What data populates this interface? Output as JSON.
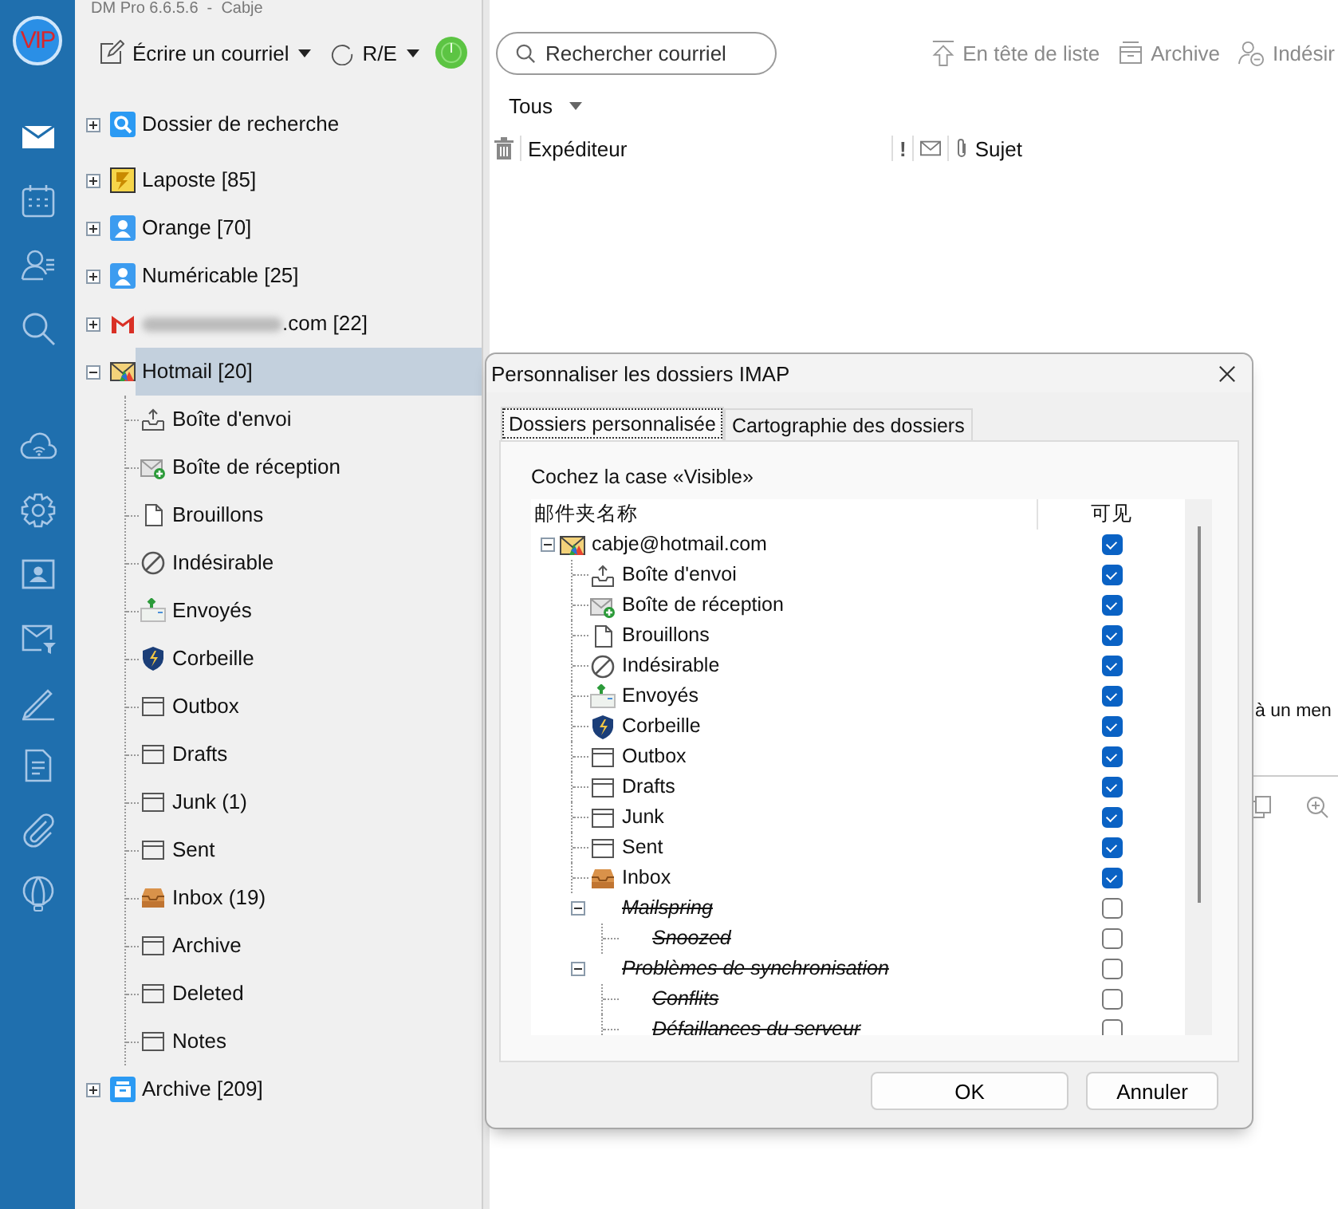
{
  "title_bar": {
    "title": "DM Pro 6.6.5.6  -  Cabje"
  },
  "rail": {
    "badge": "VIP",
    "top_items": [
      {
        "kind": "mail",
        "selected": true
      },
      {
        "kind": "calendar",
        "selected": false
      },
      {
        "kind": "contacts",
        "selected": false
      },
      {
        "kind": "search",
        "selected": false
      }
    ],
    "bottom_items": [
      {
        "kind": "cloud",
        "selected": false
      },
      {
        "kind": "settings",
        "selected": false
      },
      {
        "kind": "card",
        "selected": false
      },
      {
        "kind": "mail-filter",
        "selected": false
      },
      {
        "kind": "pen",
        "selected": false
      },
      {
        "kind": "note",
        "selected": false
      },
      {
        "kind": "clip",
        "selected": false
      },
      {
        "kind": "balloon",
        "selected": false
      }
    ]
  },
  "toolbar": {
    "compose": "Écrire un courriel",
    "send_receive": "R/E"
  },
  "sidebar": {
    "tree": [
      {
        "label": "Dossier de recherche",
        "kind": "search",
        "expanded": false,
        "selected": false
      },
      {
        "label": "Laposte [85]",
        "kind": "laposte",
        "expanded": false,
        "selected": false
      },
      {
        "label": "Orange [70]",
        "kind": "contact",
        "expanded": false,
        "selected": false
      },
      {
        "label": "Numéricable [25]",
        "kind": "contact",
        "expanded": false,
        "selected": false
      },
      {
        "label": ".com [22]",
        "kind": "gmail",
        "blurred": true,
        "expanded": false,
        "selected": false
      },
      {
        "label": "Hotmail [20]",
        "kind": "hotmail",
        "expanded": true,
        "selected": true,
        "children": [
          {
            "label": "Boîte d'envoi",
            "kind": "outbox",
            "selected": false
          },
          {
            "label": "Boîte de réception",
            "kind": "inbox-in",
            "selected": false
          },
          {
            "label": "Brouillons",
            "kind": "draft",
            "selected": false
          },
          {
            "label": "Indésirable",
            "kind": "blocked",
            "selected": false
          },
          {
            "label": "Envoyés",
            "kind": "sent",
            "selected": false
          },
          {
            "label": "Corbeille",
            "kind": "shield",
            "selected": false
          },
          {
            "label": "Outbox",
            "kind": "folder",
            "selected": false
          },
          {
            "label": "Drafts",
            "kind": "folder",
            "selected": false
          },
          {
            "label": "Junk (1)",
            "kind": "folder",
            "selected": false
          },
          {
            "label": "Sent",
            "kind": "folder",
            "selected": false
          },
          {
            "label": "Inbox (19)",
            "kind": "tray",
            "selected": false
          },
          {
            "label": "Archive",
            "kind": "folder",
            "selected": false
          },
          {
            "label": "Deleted",
            "kind": "folder",
            "selected": false
          },
          {
            "label": "Notes",
            "kind": "folder",
            "selected": false
          }
        ]
      },
      {
        "label": "Archive [209]",
        "kind": "archive",
        "expanded": false,
        "selected": false
      }
    ]
  },
  "main": {
    "search": {
      "placeholder": "Rechercher courriel"
    },
    "actions": [
      {
        "kind": "move-top",
        "label": "En tête de liste"
      },
      {
        "kind": "archive",
        "label": "Archive"
      },
      {
        "kind": "junk",
        "label": "Indésir"
      }
    ],
    "filter": "Tous",
    "columns": {
      "sender": "Expéditeur",
      "priority": "!",
      "subject": "Sujet"
    },
    "preview_text": "à un men"
  },
  "dialog": {
    "title": "Personnaliser les dossiers IMAP",
    "tabs": [
      {
        "label": "Dossiers personnalisée",
        "selected": true
      },
      {
        "label": "Cartographie des dossiers",
        "selected": false
      }
    ],
    "instruction": "Cochez la case «Visible»",
    "columns": [
      "邮件夹名称",
      "可见"
    ],
    "tree": [
      {
        "label": "cabje@hotmail.com",
        "kind": "hotmail",
        "expanded": true,
        "checked": true,
        "crossed_out": false,
        "children": [
          {
            "label": "Boîte d'envoi",
            "kind": "outbox",
            "checked": true,
            "crossed_out": false
          },
          {
            "label": "Boîte de réception",
            "kind": "inbox-in",
            "checked": true,
            "crossed_out": false
          },
          {
            "label": "Brouillons",
            "kind": "draft",
            "checked": true,
            "crossed_out": false
          },
          {
            "label": "Indésirable",
            "kind": "blocked",
            "checked": true,
            "crossed_out": false
          },
          {
            "label": "Envoyés",
            "kind": "sent",
            "checked": true,
            "crossed_out": false
          },
          {
            "label": "Corbeille",
            "kind": "shield",
            "checked": true,
            "crossed_out": false
          },
          {
            "label": "Outbox",
            "kind": "folder",
            "checked": true,
            "crossed_out": false
          },
          {
            "label": "Drafts",
            "kind": "folder",
            "checked": true,
            "crossed_out": false
          },
          {
            "label": "Junk",
            "kind": "folder",
            "checked": true,
            "crossed_out": false
          },
          {
            "label": "Sent",
            "kind": "folder",
            "checked": true,
            "crossed_out": false
          },
          {
            "label": "Inbox",
            "kind": "tray",
            "checked": true,
            "crossed_out": false
          },
          {
            "label": "Mailspring",
            "expanded": true,
            "checked": false,
            "crossed_out": true,
            "children": [
              {
                "label": "Snoozed",
                "checked": false,
                "crossed_out": true
              }
            ]
          },
          {
            "label": "Problèmes de synchronisation",
            "expanded": true,
            "checked": false,
            "crossed_out": true,
            "children": [
              {
                "label": "Conflits",
                "checked": false,
                "crossed_out": true
              },
              {
                "label": "Défaillances du serveur",
                "checked": false,
                "crossed_out": true
              }
            ]
          }
        ]
      }
    ],
    "buttons": [
      "OK",
      "Annuler"
    ]
  }
}
